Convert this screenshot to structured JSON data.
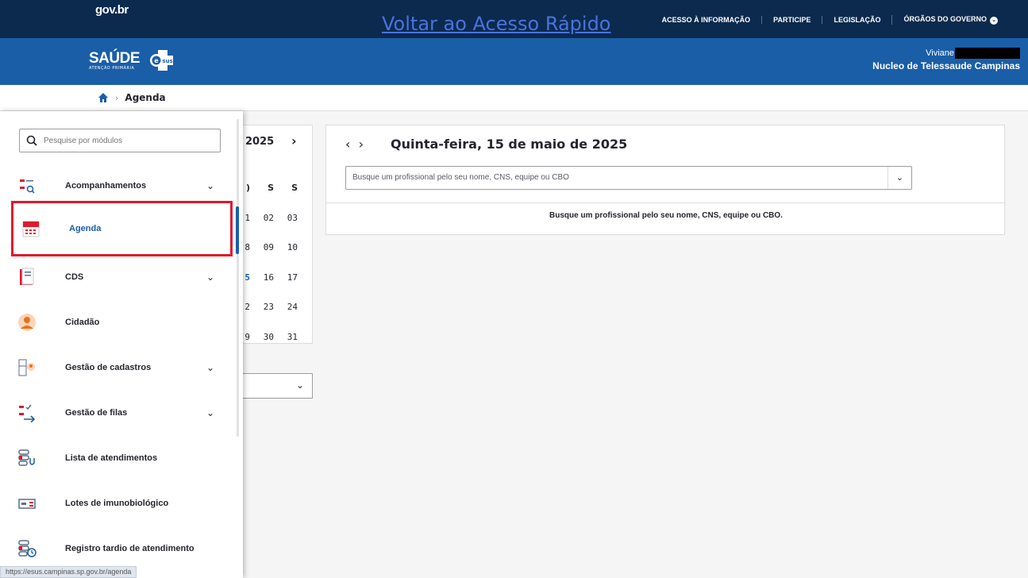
{
  "govbar": {
    "brand": "gov.br",
    "skip_link": "Voltar ao Acesso Rápido",
    "nav": [
      "ACESSO À INFORMAÇÃO",
      "PARTICIPE",
      "LEGISLAÇÃO",
      "ÓRGÃOS DO GOVERNO"
    ]
  },
  "header": {
    "logo": "SAÚDE",
    "logo_sub": "ATENÇÃO PRIMÁRIA",
    "esus": "sus",
    "user_name": "Viviane",
    "team": "Nucleo de Telessaude Campinas"
  },
  "breadcrumb": {
    "current": "Agenda"
  },
  "calendar": {
    "year": "2025",
    "next": "›",
    "header": [
      "S",
      "S",
      "S"
    ],
    "rows": [
      [
        "1",
        "02",
        "03"
      ],
      [
        "8",
        "09",
        "10"
      ],
      [
        "5",
        "16",
        "17"
      ],
      [
        "2",
        "23",
        "24"
      ],
      [
        "9",
        "30",
        "31"
      ]
    ],
    "header_partial": ")"
  },
  "panel": {
    "title": "Quinta-feira, 15 de maio de 2025",
    "search_placeholder": "Busque um profissional pelo seu nome, CNS, equipe ou CBO",
    "message": "Busque um profissional pelo seu nome, CNS, equipe ou CBO."
  },
  "sidebar": {
    "search_placeholder": "Pesquise por módulos",
    "items": [
      {
        "label": "Acompanhamentos",
        "expand": true
      },
      {
        "label": "Agenda",
        "expand": false,
        "active": true
      },
      {
        "label": "CDS",
        "expand": true
      },
      {
        "label": "Cidadão",
        "expand": false
      },
      {
        "label": "Gestão de cadastros",
        "expand": true
      },
      {
        "label": "Gestão de filas",
        "expand": true
      },
      {
        "label": "Lista de atendimentos",
        "expand": false
      },
      {
        "label": "Lotes de imunobiológico",
        "expand": false
      },
      {
        "label": "Registro tardio de atendimento",
        "expand": false
      }
    ]
  },
  "status_url": "https://esus.campinas.sp.gov.br/agenda",
  "colors": {
    "gov_blue": "#0c2a4d",
    "app_blue": "#1a5ea8",
    "highlight_red": "#e0192c"
  }
}
